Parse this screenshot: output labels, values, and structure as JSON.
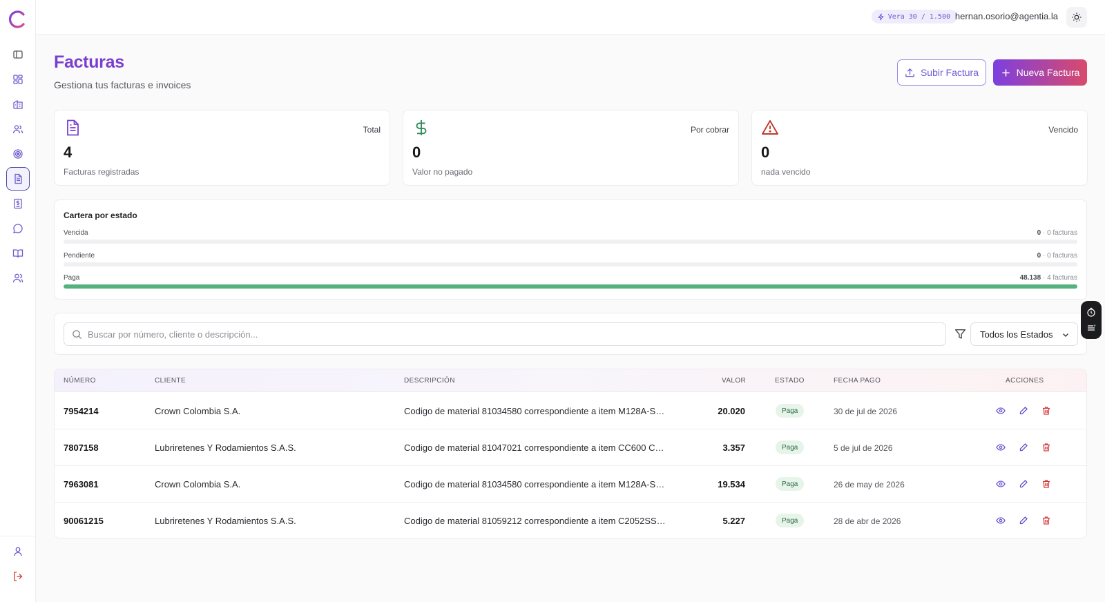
{
  "topbar": {
    "credits": "Vera 30 / 1.500",
    "user_email": "hernan.osorio@agentia.la"
  },
  "header": {
    "title": "Facturas",
    "subtitle": "Gestiona tus facturas e invoices",
    "upload_label": "Subir Factura",
    "new_label": "Nueva Factura"
  },
  "stats": [
    {
      "label": "Total",
      "value": "4",
      "desc": "Facturas registradas"
    },
    {
      "label": "Por cobrar",
      "value": "0",
      "desc": "Valor no pagado"
    },
    {
      "label": "Vencido",
      "value": "0",
      "desc": "nada vencido"
    }
  ],
  "cartera": {
    "title": "Cartera por estado",
    "rows": [
      {
        "label": "Vencida",
        "amount": "0",
        "count": " · 0 facturas",
        "fraction": 0
      },
      {
        "label": "Pendiente",
        "amount": "0",
        "count": " · 0 facturas",
        "fraction": 0
      },
      {
        "label": "Paga",
        "amount": "48.138",
        "count": " · 4 facturas",
        "fraction": 1
      }
    ]
  },
  "filters": {
    "search_placeholder": "Buscar por número, cliente o descripción...",
    "status_selected": "Todos los Estados"
  },
  "table": {
    "headers": {
      "numero": "NÚMERO",
      "cliente": "CLIENTE",
      "descripcion": "DESCRIPCIÓN",
      "valor": "VALOR",
      "estado": "ESTADO",
      "fecha": "FECHA PAGO",
      "acciones": "ACCIONES"
    },
    "rows": [
      {
        "numero": "7954214",
        "cliente": "Crown Colombia S.A.",
        "descripcion": "Codigo de material 81034580 correspondiente a item M128A-S…",
        "valor": "20.020",
        "estado": "Paga",
        "fecha": "30 de jul de 2026"
      },
      {
        "numero": "7807158",
        "cliente": "Lubriretenes Y Rodamientos S.A.S.",
        "descripcion": "Codigo de material 81047021 correspondiente a item CC600 C…",
        "valor": "3.357",
        "estado": "Paga",
        "fecha": "5 de jul de 2026"
      },
      {
        "numero": "7963081",
        "cliente": "Crown Colombia S.A.",
        "descripcion": "Codigo de material 81034580 correspondiente a item M128A-S…",
        "valor": "19.534",
        "estado": "Paga",
        "fecha": "26 de may de 2026"
      },
      {
        "numero": "90061215",
        "cliente": "Lubriretenes Y Rodamientos S.A.S.",
        "descripcion": "Codigo de material 81059212 correspondiente a item C2052SS…",
        "valor": "5.227",
        "estado": "Paga",
        "fecha": "28 de abr de 2026"
      }
    ]
  },
  "colors": {
    "accent": "#7a3fd0",
    "paid_bar": "#55b27f",
    "danger": "#d43a3a",
    "success_icon": "#2f8a5b"
  },
  "icons": {
    "sidebar": [
      "sidebar-toggle-icon",
      "dashboard-icon",
      "building-icon",
      "users-icon",
      "target-icon",
      "invoice-icon",
      "receipt-icon",
      "chat-icon",
      "book-icon",
      "contacts-icon"
    ],
    "sidebar_bottom": [
      "profile-icon",
      "logout-icon"
    ]
  }
}
